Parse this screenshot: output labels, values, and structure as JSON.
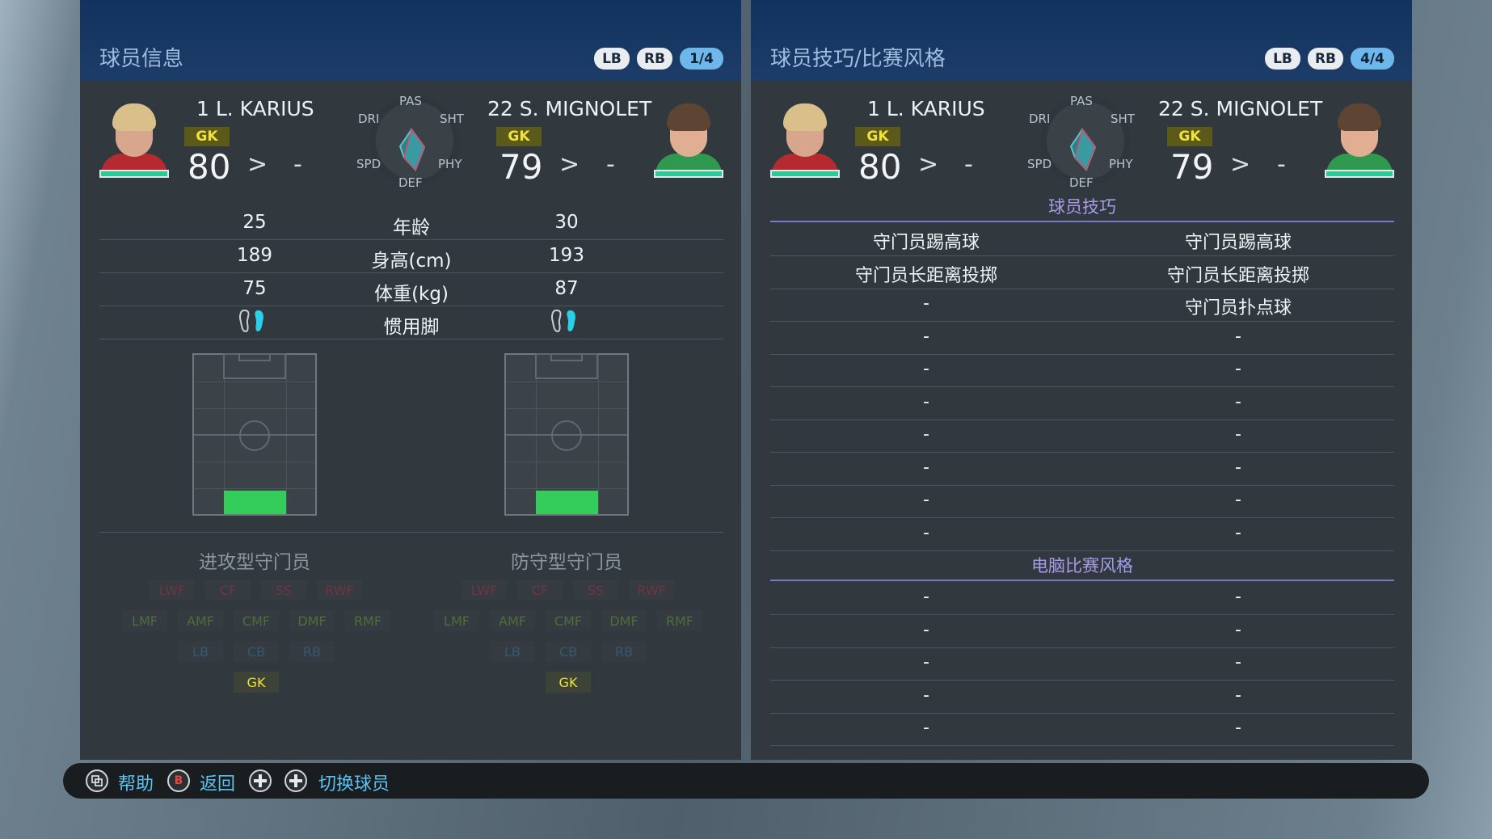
{
  "left_panel": {
    "title": "球员信息",
    "shoulder_left": "LB",
    "shoulder_right": "RB",
    "page": "1/4"
  },
  "right_panel": {
    "title": "球员技巧/比赛风格",
    "shoulder_left": "LB",
    "shoulder_right": "RB",
    "page": "4/4"
  },
  "player1": {
    "name": "1 L. KARIUS",
    "position": "GK",
    "rating": "80",
    "arrow": ">",
    "next": "-",
    "age": "25",
    "height": "189",
    "weight": "75",
    "play_style": "进攻型守门员",
    "footedness": "right"
  },
  "player2": {
    "name": "22 S. MIGNOLET",
    "position": "GK",
    "rating": "79",
    "arrow": ">",
    "next": "-",
    "age": "30",
    "height": "193",
    "weight": "87",
    "play_style": "防守型守门员",
    "footedness": "right"
  },
  "radar_labels": {
    "pas": "PAS",
    "sht": "SHT",
    "phy": "PHY",
    "def": "DEF",
    "spd": "SPD",
    "dri": "DRI"
  },
  "attr_labels": {
    "age": "年龄",
    "height": "身高(cm)",
    "weight": "体重(kg)",
    "foot": "惯用脚"
  },
  "positions": {
    "forwards": [
      "LWF",
      "CF",
      "SS",
      "RWF"
    ],
    "midfielders": [
      "LMF",
      "AMF",
      "CMF",
      "DMF",
      "RMF"
    ],
    "defenders": [
      "LB",
      "CB",
      "RB"
    ],
    "goalkeeper": "GK"
  },
  "skills": {
    "section_title": "球员技巧",
    "rows": [
      [
        "守门员踢高球",
        "守门员踢高球"
      ],
      [
        "守门员长距离投掷",
        "守门员长距离投掷"
      ],
      [
        "-",
        "守门员扑点球"
      ],
      [
        "-",
        "-"
      ],
      [
        "-",
        "-"
      ],
      [
        "-",
        "-"
      ],
      [
        "-",
        "-"
      ],
      [
        "-",
        "-"
      ],
      [
        "-",
        "-"
      ],
      [
        "-",
        "-"
      ]
    ]
  },
  "com_styles": {
    "section_title": "电脑比赛风格",
    "rows": [
      [
        "-",
        "-"
      ],
      [
        "-",
        "-"
      ],
      [
        "-",
        "-"
      ],
      [
        "-",
        "-"
      ],
      [
        "-",
        "-"
      ]
    ]
  },
  "footer": {
    "help_icon": "view-button-icon",
    "help": "帮助",
    "back_key": "B",
    "back": "返回",
    "dpad1_icon": "dpad-icon",
    "dpad2_icon": "dpad-icon",
    "switch": "切换球员"
  },
  "colors": {
    "header_blue": "#12325f",
    "panel_bg": "#31393f",
    "accent_cyan": "#5bc2f0",
    "gk_yellow": "#f1e13b",
    "section_purple": "#a79ae8",
    "pitch_green": "#34cc5a"
  }
}
